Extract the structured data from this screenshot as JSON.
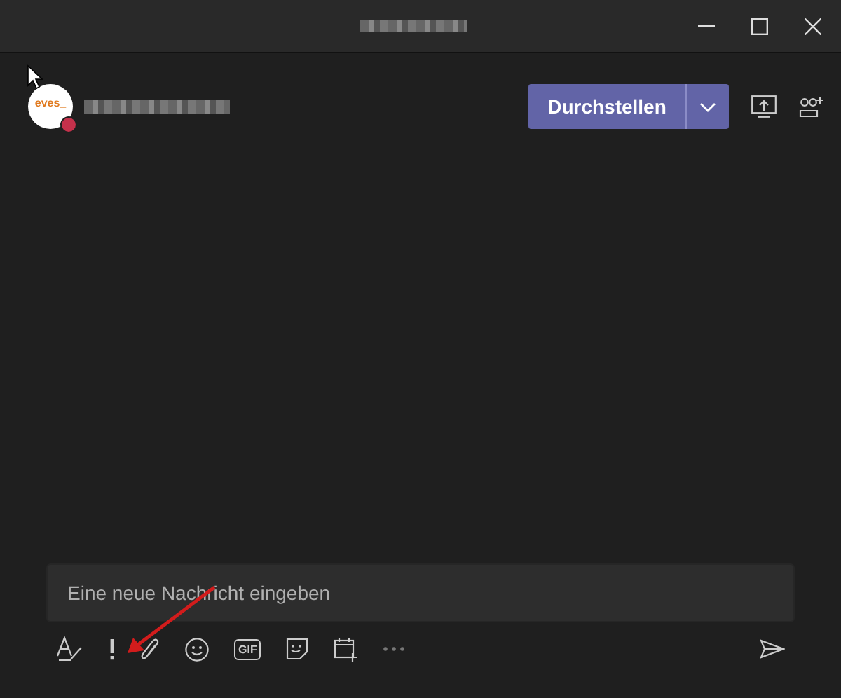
{
  "chat_header": {
    "avatar": {
      "text": "eves_",
      "color": "#c4314b"
    },
    "call_button": {
      "label": "Durchstellen"
    }
  },
  "compose": {
    "placeholder": "Eine neue Nachricht eingeben"
  },
  "toolbar": {
    "gif_label": "GIF"
  }
}
